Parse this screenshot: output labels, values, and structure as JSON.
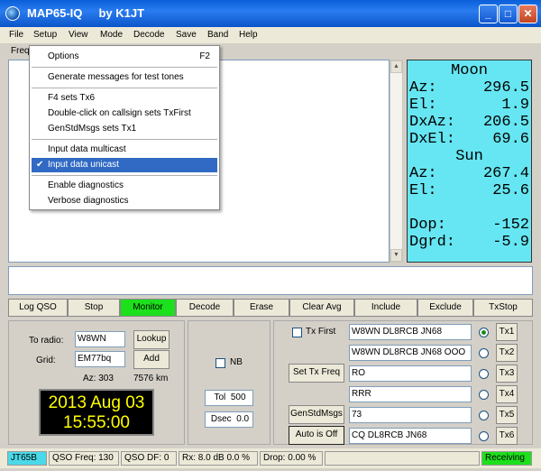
{
  "window": {
    "title": "MAP65-IQ     by K1JT"
  },
  "menubar": [
    "File",
    "Setup",
    "View",
    "Mode",
    "Decode",
    "Save",
    "Band",
    "Help"
  ],
  "toolbar_fragment": "Freq",
  "setup_menu": [
    {
      "label": "Options",
      "shortcut": "F2"
    },
    {
      "label": "Generate messages for test tones"
    },
    {
      "label": "F4 sets Tx6"
    },
    {
      "label": "Double-click on callsign sets TxFirst"
    },
    {
      "label": "GenStdMsgs sets Tx1"
    },
    {
      "label": "Input data multicast"
    },
    {
      "label": "Input data unicast",
      "checked": true,
      "selected": true
    },
    {
      "label": "Enable diagnostics"
    },
    {
      "label": "Verbose diagnostics"
    }
  ],
  "astro": {
    "moon_header": "Moon",
    "moon_az_label": "Az:",
    "moon_az": "296.5",
    "moon_el_label": "El:",
    "moon_el": "1.9",
    "dxaz_label": "DxAz:",
    "dxaz": "206.5",
    "dxel_label": "DxEl:",
    "dxel": "69.6",
    "sun_header": "Sun",
    "sun_az_label": "Az:",
    "sun_az": "267.4",
    "sun_el_label": "El:",
    "sun_el": "25.6",
    "dop_label": "Dop:",
    "dop": "-152",
    "dgrd_label": "Dgrd:",
    "dgrd": "-5.9",
    "bg_color": "#66e6f2"
  },
  "buttons": {
    "log_qso": "Log QSO",
    "stop": "Stop",
    "monitor": "Monitor",
    "decode": "Decode",
    "erase": "Erase",
    "clear_avg": "Clear Avg",
    "include": "Include",
    "exclude": "Exclude",
    "txstop": "TxStop",
    "monitor_color": "#1ce01c"
  },
  "station": {
    "to_radio_label": "To radio:",
    "to_radio": "W8WN",
    "grid_label": "Grid:",
    "grid": "EM77bq",
    "lookup": "Lookup",
    "add": "Add",
    "az_label": "Az: 303",
    "dist": "7576 km",
    "date": "2013 Aug 03",
    "time": "15:55:00"
  },
  "mid_panel": {
    "nb": "NB",
    "tol_label": "Tol",
    "tol": "500",
    "dsec_label": "Dsec",
    "dsec": "0.0"
  },
  "tx_panel": {
    "tx_first": "Tx First",
    "set_tx_freq": "Set Tx Freq",
    "gen_std_msgs": "GenStdMsgs",
    "auto_is_off": "Auto is Off",
    "messages": [
      {
        "text": "W8WN DL8RCB JN68",
        "button": "Tx1",
        "selected": true
      },
      {
        "text": "W8WN DL8RCB JN68 OOO",
        "button": "Tx2"
      },
      {
        "text": "RO",
        "button": "Tx3"
      },
      {
        "text": "RRR",
        "button": "Tx4"
      },
      {
        "text": "73",
        "button": "Tx5"
      },
      {
        "text": "CQ DL8RCB JN68",
        "button": "Tx6"
      }
    ]
  },
  "status": {
    "mode": "JT65B",
    "qso_freq": "QSO Freq: 130",
    "qso_df": "QSO DF:  0",
    "rx": "Rx: 8.0 dB  0.0 %",
    "drop": "Drop: 0.00 %",
    "receiving": "Receiving",
    "mode_color": "#4ad9e8",
    "receiving_color": "#1ce01c"
  }
}
